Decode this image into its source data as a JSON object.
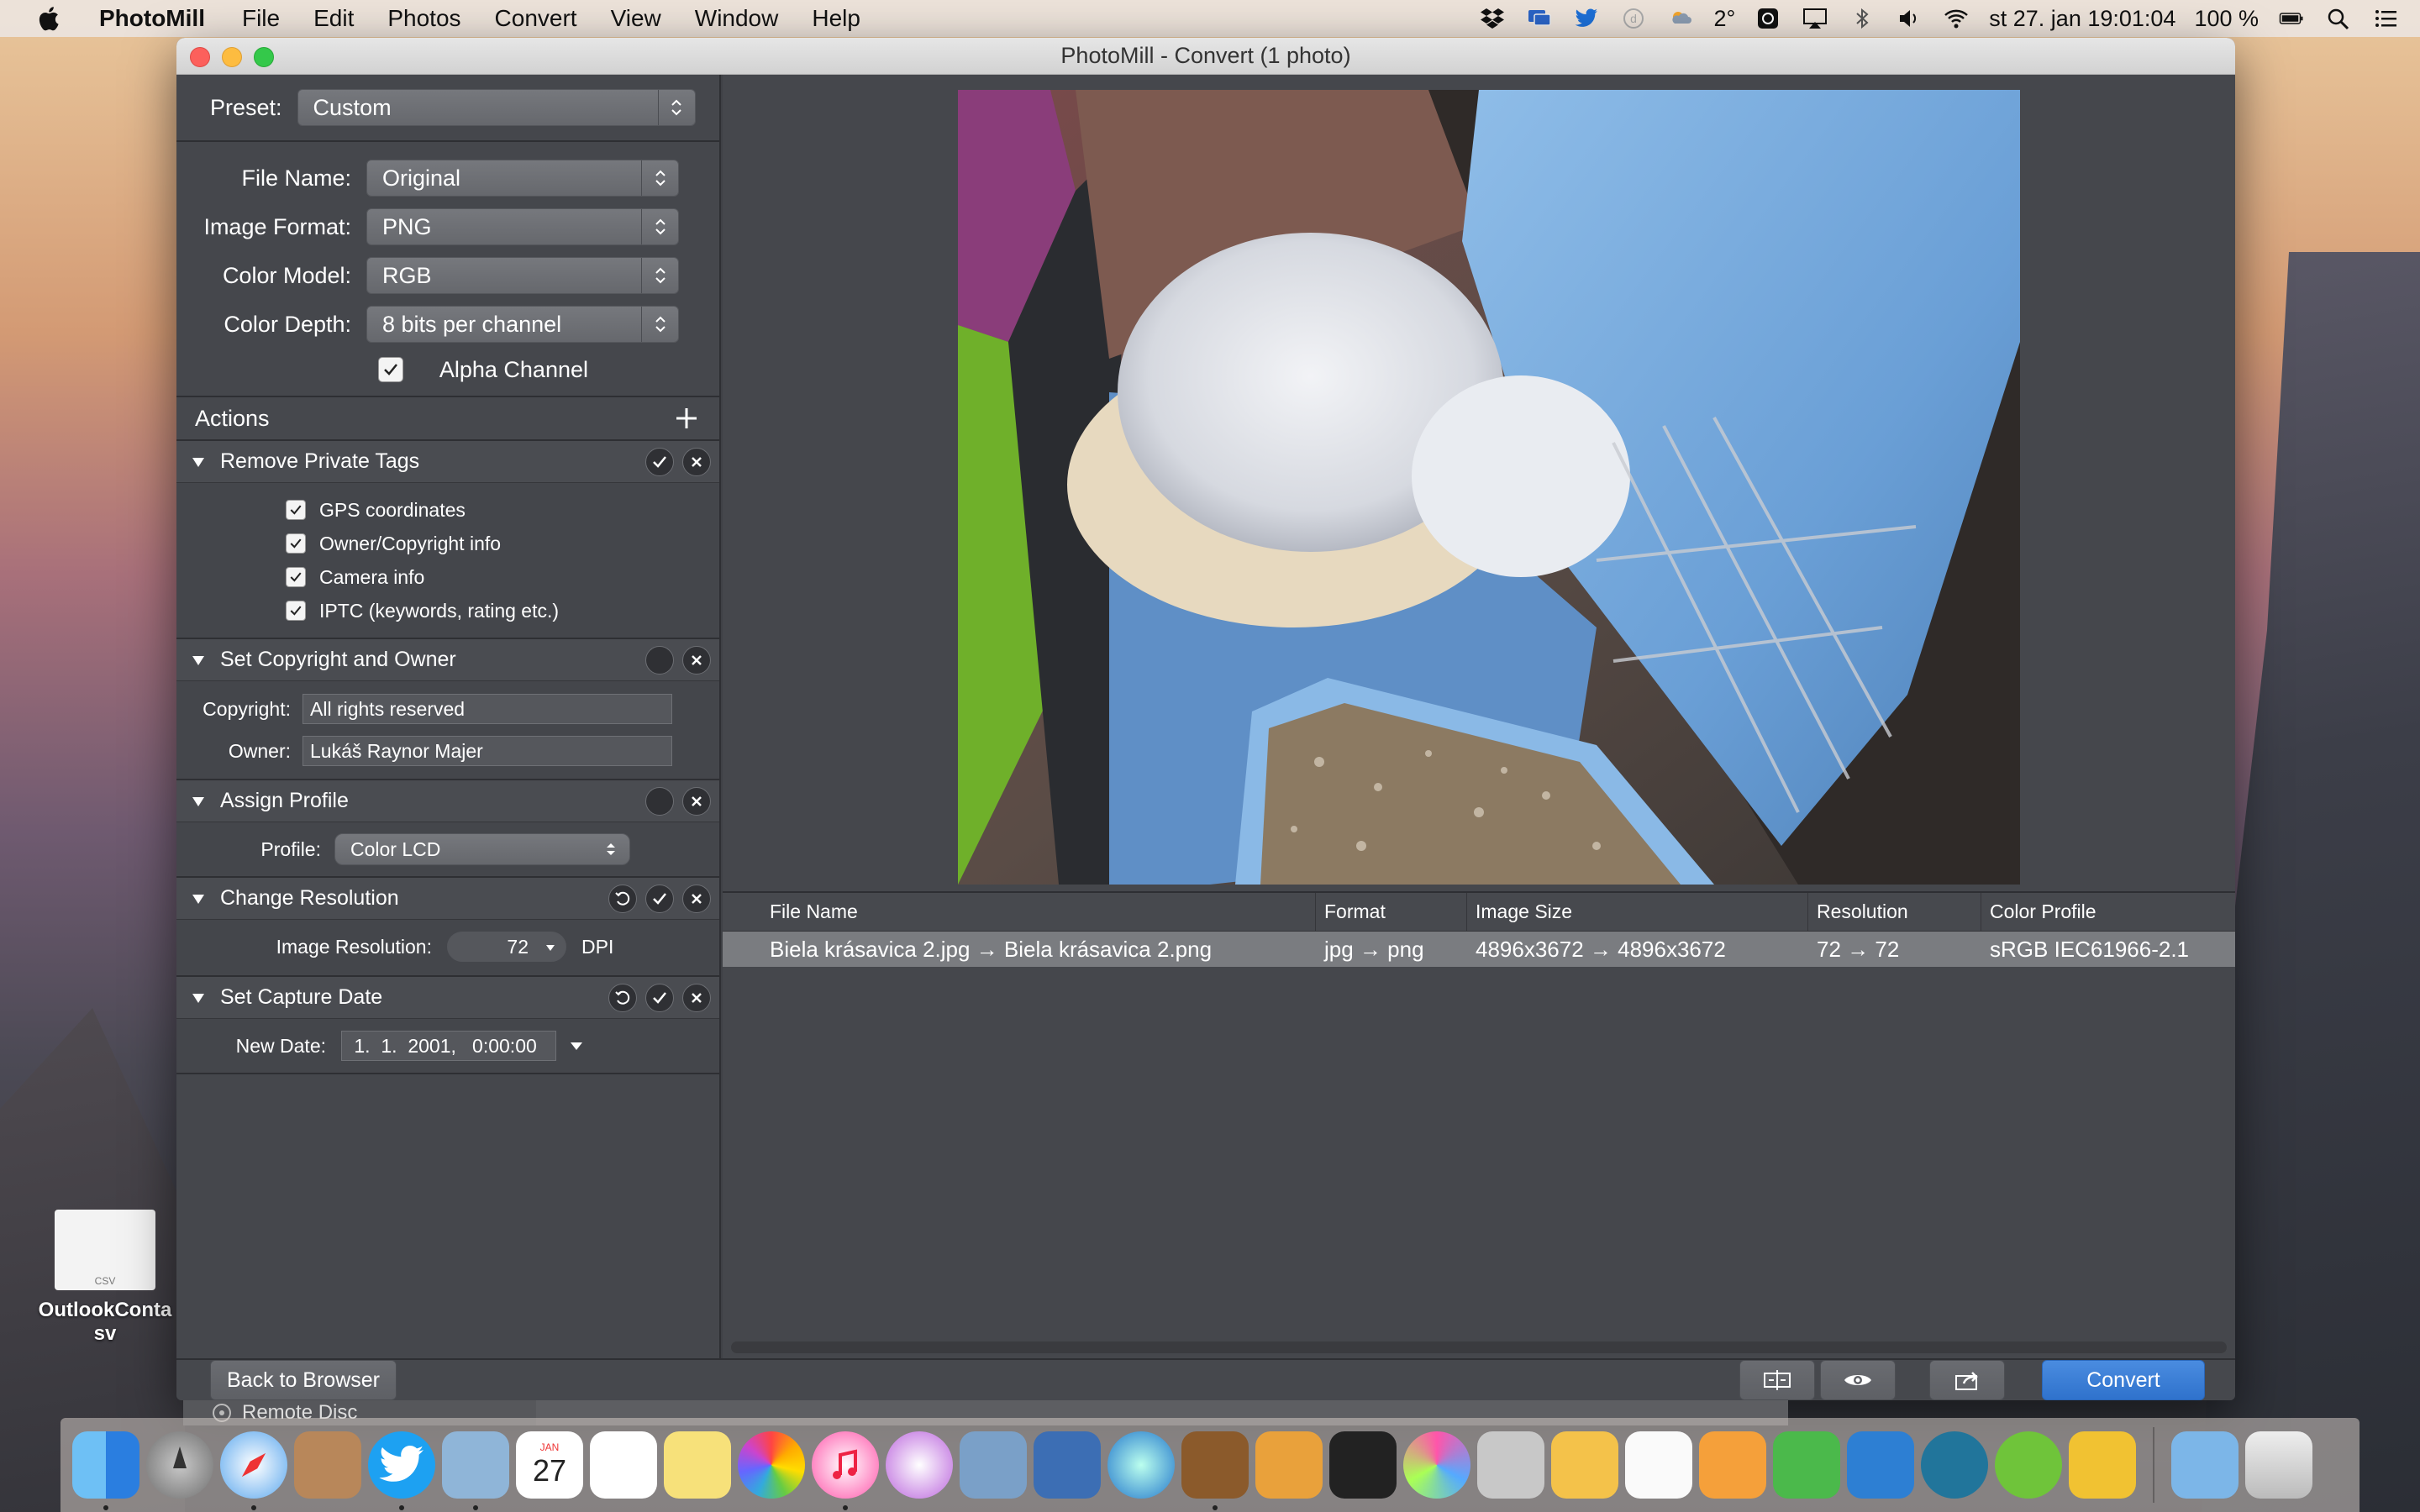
{
  "menubar": {
    "app_name": "PhotoMill",
    "items": [
      "File",
      "Edit",
      "Photos",
      "Convert",
      "View",
      "Window",
      "Help"
    ],
    "temperature": "2°",
    "datetime": "st 27. jan  19:01:04",
    "battery": "100 %"
  },
  "window": {
    "title": "PhotoMill - Convert (1 photo)"
  },
  "sidebar": {
    "preset_label": "Preset:",
    "preset_value": "Custom",
    "file_name_label": "File Name:",
    "file_name_value": "Original",
    "image_format_label": "Image Format:",
    "image_format_value": "PNG",
    "color_model_label": "Color Model:",
    "color_model_value": "RGB",
    "color_depth_label": "Color Depth:",
    "color_depth_value": "8 bits per channel",
    "alpha_channel_label": "Alpha Channel",
    "alpha_channel_checked": true,
    "actions_label": "Actions"
  },
  "actions": {
    "remove_private_tags": {
      "title": "Remove Private Tags",
      "items": [
        "GPS coordinates",
        "Owner/Copyright info",
        "Camera info",
        "IPTC (keywords, rating etc.)"
      ]
    },
    "set_copyright": {
      "title": "Set Copyright and Owner",
      "copyright_label": "Copyright:",
      "copyright_value": "All rights reserved",
      "owner_label": "Owner:",
      "owner_value": "Lukáš Raynor Majer"
    },
    "assign_profile": {
      "title": "Assign Profile",
      "profile_label": "Profile:",
      "profile_value": "Color LCD"
    },
    "change_resolution": {
      "title": "Change Resolution",
      "resolution_label": "Image Resolution:",
      "resolution_value": "72",
      "resolution_unit": "DPI"
    },
    "set_capture_date": {
      "title": "Set Capture Date",
      "date_label": "New Date:",
      "date_value": " 1.  1.  2001,   0:00:00"
    }
  },
  "table": {
    "columns": [
      "File Name",
      "Format",
      "Image Size",
      "Resolution",
      "Color Profile"
    ],
    "rows": [
      {
        "file_name": "Biela krásavica 2.jpg → Biela krásavica 2.png",
        "format": "jpg → png",
        "image_size": "4896x3672 → 4896x3672",
        "resolution": "72 → 72",
        "color_profile": "sRGB IEC61966-2.1"
      }
    ]
  },
  "bottombar": {
    "back_label": "Back to Browser",
    "convert_label": "Convert"
  },
  "desktop": {
    "file_name": "OutlookContacts.csv",
    "file_name_visible": "OutlookConta",
    "file_name_line2": "sv",
    "file_type": "CSV",
    "remote_disc": "Remote Disc"
  },
  "dock": {
    "calendar_month": "JAN",
    "calendar_day": "27"
  },
  "colors": {
    "accent": "#2f72cc",
    "window_bg": "#3f4146",
    "selected_row": "#7a7c80"
  }
}
